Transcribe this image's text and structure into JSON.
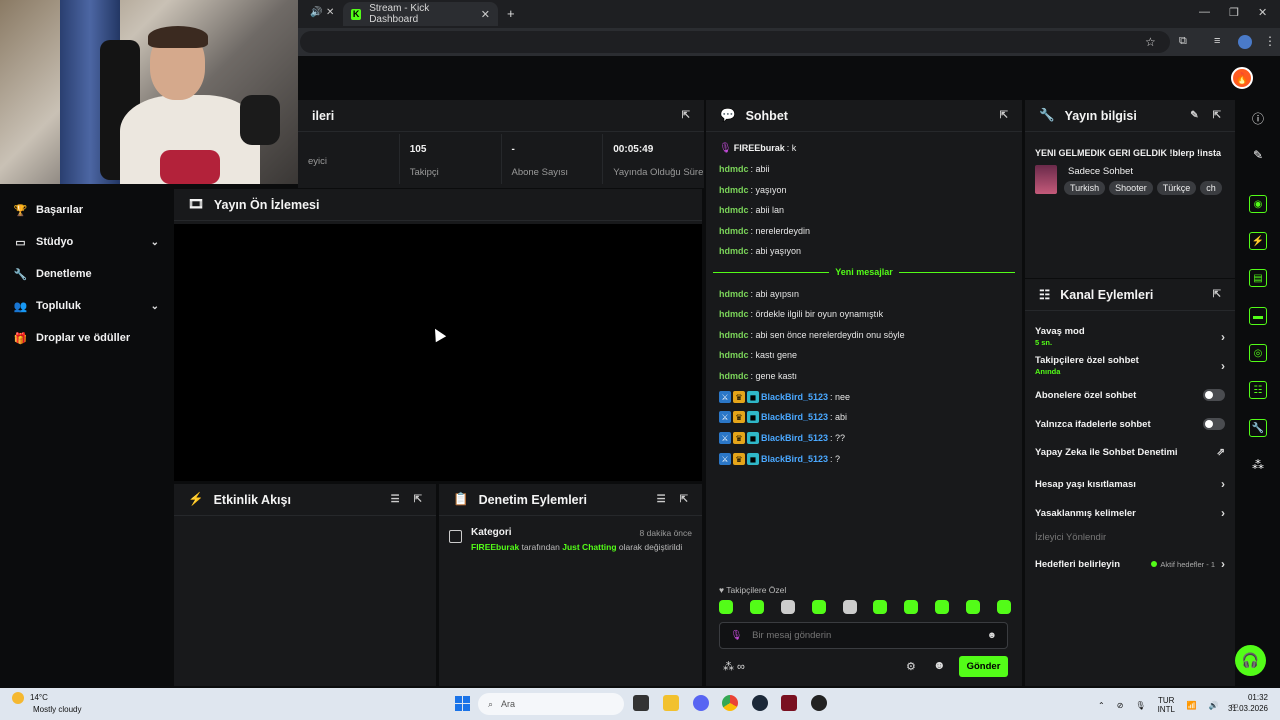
{
  "browser": {
    "tab_title": "Stream - Kick Dashboard",
    "tab_icon": "kick-logo-icon"
  },
  "header": {
    "avatar_emoji": "🔥"
  },
  "sidebar": {
    "items": [
      {
        "label": "Başarılar",
        "icon": "trophy-icon"
      },
      {
        "label": "Stüdyo",
        "icon": "studio-icon",
        "expandable": true
      },
      {
        "label": "Denetleme",
        "icon": "wrench-icon"
      },
      {
        "label": "Topluluk",
        "icon": "community-icon",
        "expandable": true
      },
      {
        "label": "Droplar ve ödüller",
        "icon": "gift-icon"
      }
    ]
  },
  "stats": {
    "title_fragment": "ileri",
    "items": [
      {
        "value": "",
        "label": "eyici"
      },
      {
        "value": "105",
        "label": "Takipçi"
      },
      {
        "value": "-",
        "label": "Abone Sayısı"
      },
      {
        "value": "00:05:49",
        "label": "Yayında Olduğu Süre"
      }
    ]
  },
  "preview": {
    "title": "Yayın Ön İzlemesi"
  },
  "activity": {
    "title": "Etkinlik Akışı"
  },
  "mod_actions": {
    "title": "Denetim Eylemleri",
    "entry": {
      "title": "Kategori",
      "time": "8 dakika önce",
      "user": "FIREEburak",
      "middle": "tarafından",
      "category": "Just Chatting",
      "suffix": "olarak değiştirildi"
    }
  },
  "chat": {
    "title": "Sohbet",
    "messages_before": [
      {
        "user": "FIREEburak",
        "text": ": k",
        "style": "owner"
      },
      {
        "user": "hdmdc",
        "text": ": abii"
      },
      {
        "user": "hdmdc",
        "text": ": yaşıyon"
      },
      {
        "user": "hdmdc",
        "text": ": abii lan"
      },
      {
        "user": "hdmdc",
        "text": ": nerelerdeydin"
      },
      {
        "user": "hdmdc",
        "text": ": abi yaşıyon"
      }
    ],
    "new_messages_label": "Yeni mesajlar",
    "messages_after": [
      {
        "user": "hdmdc",
        "text": ": abi ayıpsın"
      },
      {
        "user": "hdmdc",
        "text": ": ördekle ilgili bir oyun oynamıştık"
      },
      {
        "user": "hdmdc",
        "text": ": abi sen önce nerelerdeydin onu söyle"
      },
      {
        "user": "hdmdc",
        "text": ": kastı gene"
      },
      {
        "user": "hdmdc",
        "text": ": gene kastı"
      },
      {
        "user": "BlackBird_5123",
        "text": ": nee"
      },
      {
        "user": "BlackBird_5123",
        "text": ": abi"
      },
      {
        "user": "BlackBird_5123",
        "text": ": ??"
      },
      {
        "user": "BlackBird_5123",
        "text": ": ?"
      }
    ],
    "followers_only": "Takipçilere Özel",
    "input_placeholder": "Bir mesaj gönderin",
    "send_label": "Gönder"
  },
  "stream_info": {
    "title": "Yayın bilgisi",
    "stream_title": "YENI GELMEDIK GERI GELDIK !blerp !insta",
    "category": "Sadece Sohbet",
    "tags": [
      "Turkish",
      "Shooter",
      "Türkçe",
      "ch"
    ]
  },
  "channel_actions": {
    "title": "Kanal Eylemleri",
    "slow_mode": {
      "label": "Yavaş mod",
      "sub": "5 sn."
    },
    "followers_chat": {
      "label": "Takipçilere özel sohbet",
      "sub": "Anında"
    },
    "subs_chat": "Abonelere özel sohbet",
    "emote_chat": "Yalnızca ifadelerle sohbet",
    "ai_mod": "Yapay Zeka ile Sohbet Denetimi",
    "age_restrict": "Hesap yaşı kısıtlaması",
    "banned_words": "Yasaklanmış kelimeler",
    "viewer_redirect": "İzleyici Yönlendir",
    "goals": "Hedefleri belirleyin",
    "goals_status": "Aktif hedefler - 1"
  },
  "taskbar": {
    "temp": "14°C",
    "weather": "Mostly cloudy",
    "search_placeholder": "Ara",
    "lang1": "TUR",
    "lang2": "INTL",
    "time": "01:32",
    "date": "31.03.2026"
  },
  "colors": {
    "accent": "#53fc18",
    "panel": "#18191b",
    "bg": "#0b0c0d"
  }
}
